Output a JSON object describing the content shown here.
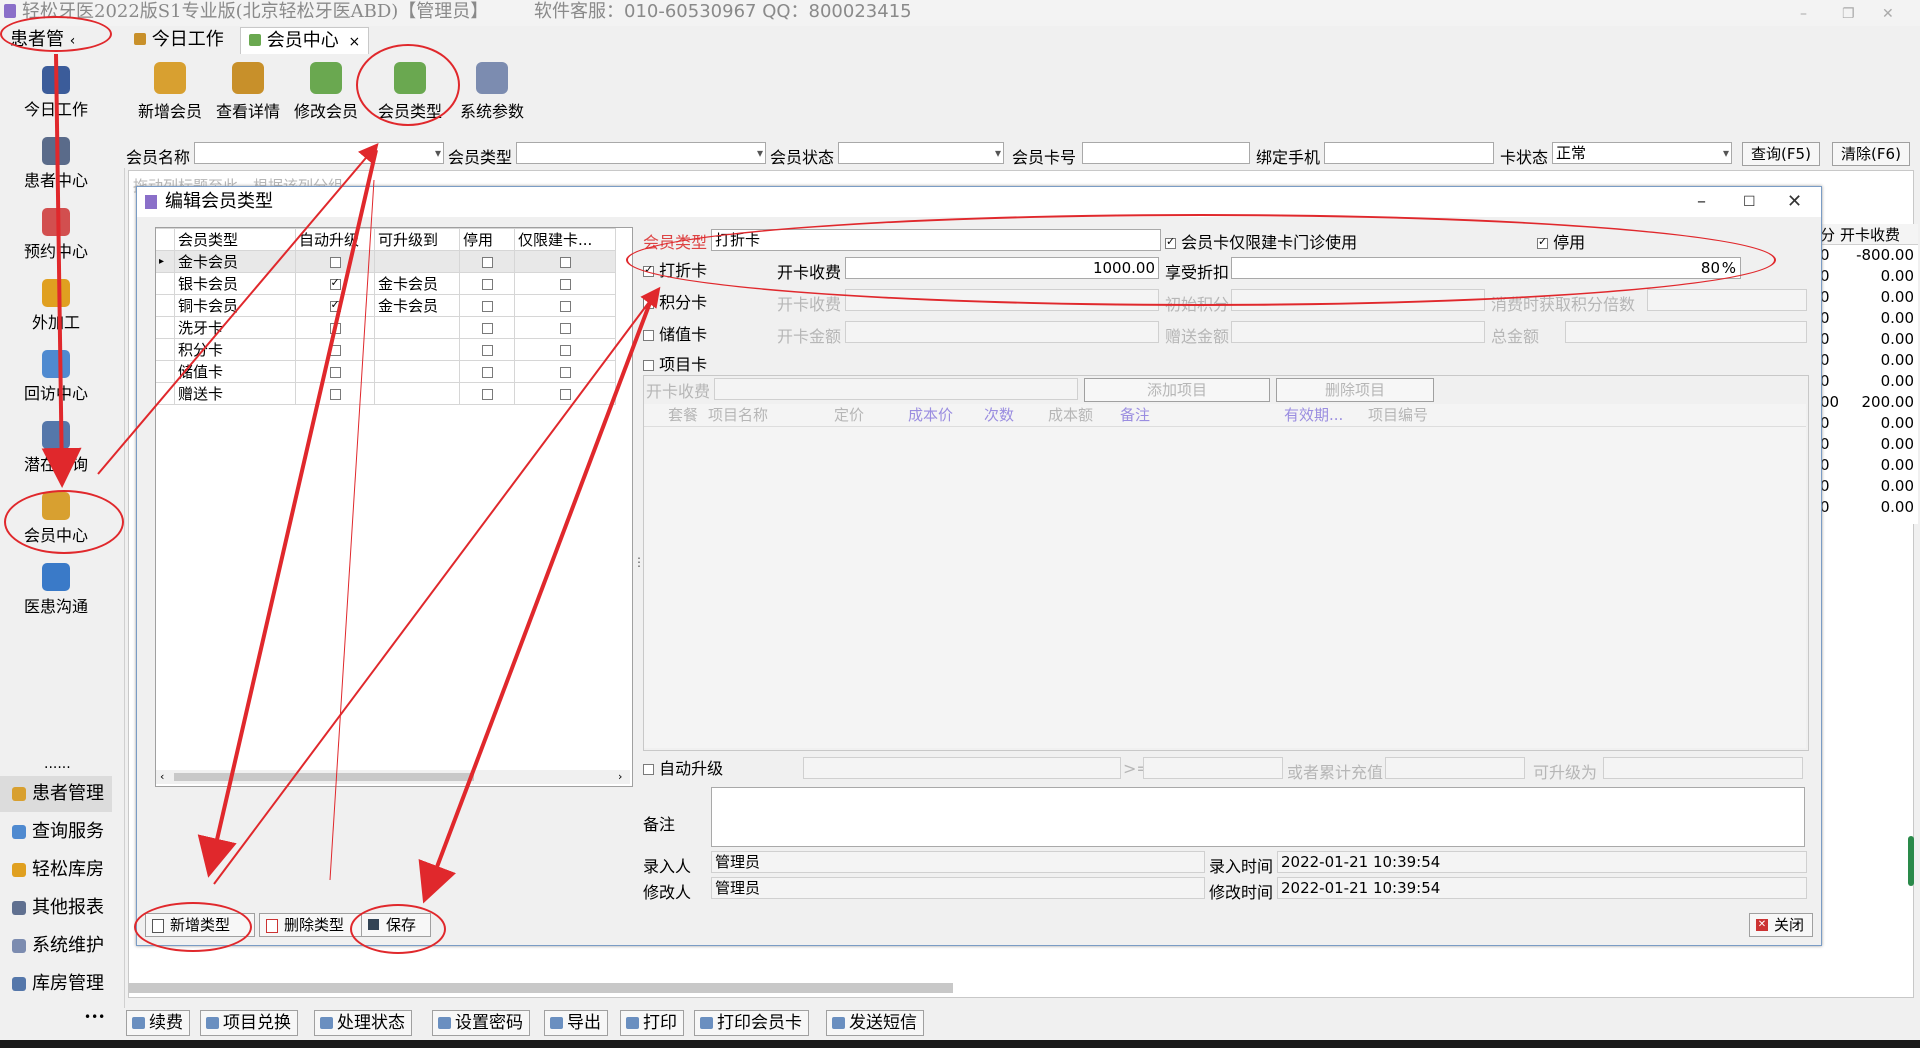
{
  "app": {
    "title": "轻松牙医2022版S1专业版(北京轻松牙医ABD)【管理员】",
    "support": "软件客服：010-60530967 QQ：800023415"
  },
  "tabs": [
    {
      "label": "患者管",
      "arrow": "‹"
    },
    {
      "label": "今日工作"
    },
    {
      "label": "会员中心",
      "close": "×"
    }
  ],
  "sidebar": {
    "items": [
      "今日工作",
      "患者中心",
      "预约中心",
      "外加工",
      "回访中心",
      "潜在咨询",
      "会员中心",
      "医患沟通"
    ],
    "more": "......",
    "bottom": [
      "患者管理",
      "查询服务",
      "轻松库房",
      "其他报表",
      "系统维护",
      "库房管理"
    ],
    "dots": "•••"
  },
  "ribbon": [
    "新增会员",
    "查看详情",
    "修改会员",
    "会员类型",
    "系统参数"
  ],
  "filter": {
    "labels": [
      "会员名称",
      "会员类型",
      "会员状态",
      "会员卡号",
      "绑定手机",
      "卡状态"
    ],
    "card_status_value": "正常",
    "query_btn": "查询(F5)",
    "clear_btn": "清除(F6)",
    "hint": "拖动列标题至此，根据该列分组"
  },
  "background_grid": {
    "header": [
      "分",
      "开卡收费"
    ],
    "rows": [
      [
        "0",
        "-800.00"
      ],
      [
        "0",
        "0.00"
      ],
      [
        "0",
        "0.00"
      ],
      [
        "0",
        "0.00"
      ],
      [
        "0",
        "0.00"
      ],
      [
        "0",
        "0.00"
      ],
      [
        "0",
        "0.00"
      ],
      [
        "00",
        "200.00"
      ],
      [
        "0",
        "0.00"
      ],
      [
        "0",
        "0.00"
      ],
      [
        "0",
        "0.00"
      ],
      [
        "0",
        "0.00"
      ],
      [
        "0",
        "0.00"
      ]
    ]
  },
  "dialog": {
    "title": "编辑会员类型",
    "grid": {
      "headers": [
        "会员类型",
        "自动升级",
        "可升级到",
        "停用",
        "仅限建卡..."
      ],
      "rows": [
        {
          "name": "金卡会员",
          "auto": false,
          "upgrade": ""
        },
        {
          "name": "银卡会员",
          "auto": true,
          "upgrade": "金卡会员"
        },
        {
          "name": "铜卡会员",
          "auto": true,
          "upgrade": "金卡会员"
        },
        {
          "name": "洗牙卡",
          "auto": false,
          "upgrade": ""
        },
        {
          "name": "积分卡",
          "auto": false,
          "upgrade": ""
        },
        {
          "name": "储值卡",
          "auto": false,
          "upgrade": ""
        },
        {
          "name": "赠送卡",
          "auto": false,
          "upgrade": ""
        }
      ]
    },
    "form": {
      "type_label": "会员类型",
      "type_value": "打折卡",
      "clinic_only": "会员卡仅限建卡门诊使用",
      "disabled": "停用",
      "discount_card": "打折卡",
      "open_fee": "开卡收费",
      "open_fee_value": "1000.00",
      "discount": "享受折扣",
      "discount_value": "80",
      "percent": "%",
      "points_card": "积分卡",
      "open_fee2": "开卡收费",
      "init_points": "初始积分",
      "points_multiple": "消费时获取积分倍数",
      "stored_card": "储值卡",
      "open_amount": "开卡金额",
      "gift_amount": "赠送金额",
      "total_amount": "总金额",
      "item_card": "项目卡",
      "item_fee": "开卡收费",
      "add_item": "添加项目",
      "del_item": "删除项目",
      "item_headers": [
        "套餐",
        "项目名称",
        "定价",
        "成本价",
        "次数",
        "成本额",
        "备注",
        "有效期...",
        "项目编号"
      ],
      "auto_upgrade": "自动升级",
      "gte": ">=",
      "or_total": "或者累计充值",
      "can_upgrade": "可升级为",
      "remark": "备注",
      "entry_person": "录入人",
      "entry_person_value": "管理员",
      "entry_time": "录入时间",
      "entry_time_value": "2022-01-21 10:39:54",
      "modify_person": "修改人",
      "modify_person_value": "管理员",
      "modify_time": "修改时间",
      "modify_time_value": "2022-01-21 10:39:54"
    },
    "buttons": {
      "add_type": "新增类型",
      "del_type": "删除类型",
      "save": "保存",
      "close": "关闭"
    }
  },
  "bottombar": [
    "续费",
    "项目兑换",
    "处理状态",
    "设置密码",
    "导出",
    "打印",
    "打印会员卡",
    "发送短信"
  ],
  "colors": {
    "annotation": "#e0282c",
    "accent": "#7a9cc5"
  }
}
